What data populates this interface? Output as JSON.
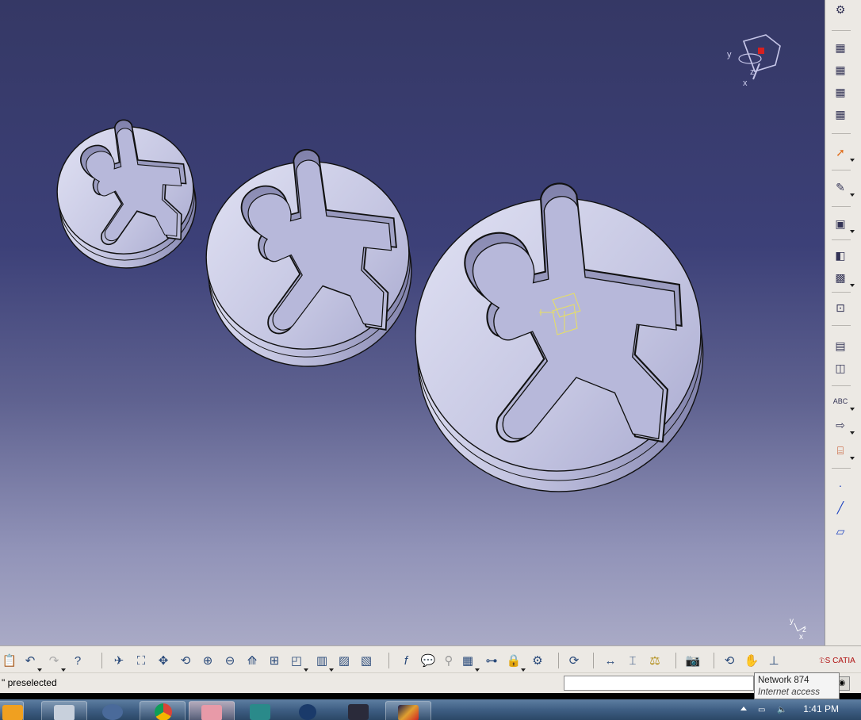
{
  "status": {
    "text": "\" preselected",
    "command_input_value": ""
  },
  "tooltip": {
    "title": "Network  874",
    "subtitle": "Internet access"
  },
  "taskbar": {
    "clock_time": "1:41 PM"
  },
  "compass_axes": {
    "y": "y",
    "z": "z",
    "x": "x"
  },
  "mini_axes": {
    "y": "y",
    "z": "z",
    "x": "x"
  },
  "right_toolbar_icons": [
    "settings-gear-icon",
    "part-icon-1",
    "part-icon-2",
    "part-icon-3",
    "part-icon-4",
    "select-arrow-icon",
    "sketch-icon",
    "part-body-icon",
    "pattern-icon",
    "grid-icon",
    "snap-icon",
    "fixture-icon",
    "box-icon",
    "text-abc-icon",
    "arrow-shape-icon",
    "measure-icon",
    "point-icon",
    "line-icon",
    "plane-icon"
  ],
  "bottom_toolbar_icons": [
    "paste-icon",
    "undo-icon",
    "redo-icon",
    "whats-this-icon",
    "fly-mode-icon",
    "fit-all-icon",
    "pan-icon",
    "rotate-icon",
    "zoom-in-icon",
    "zoom-out-icon",
    "normal-view-icon",
    "multi-view-icon",
    "iso-view-icon",
    "view-mode-icon",
    "hide-show-icon",
    "swap-space-icon",
    "formula-icon",
    "comment-icon",
    "knowledge-icon",
    "table-icon",
    "tree-icon",
    "lock-icon",
    "parameters-icon",
    "update-icon",
    "measure-between-icon",
    "measure-item-icon",
    "mass-icon",
    "capture-icon",
    "refresh-icon",
    "hand-icon",
    "compass-icon",
    "catia-logo-icon"
  ],
  "colors": {
    "background_top": "#353865",
    "background_bottom": "#a9aac6",
    "part_face": "#c9cae6",
    "part_shadow": "#8e8fb8",
    "edge": "#111111",
    "highlight": "#e8e060"
  }
}
